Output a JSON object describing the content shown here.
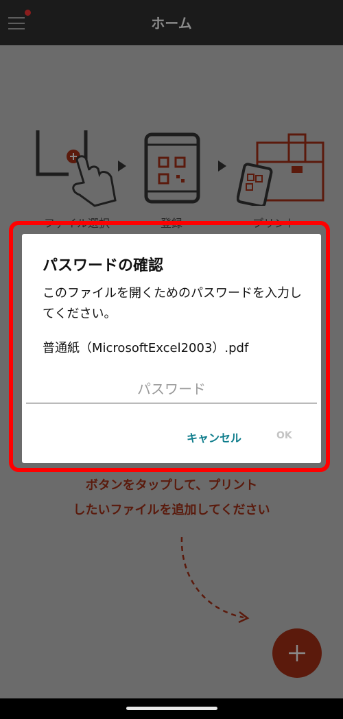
{
  "appbar": {
    "title": "ホーム",
    "menu_icon": "hamburger-menu-icon",
    "notification_dot_color": "#8a1d1d"
  },
  "steps": [
    {
      "label": "ファイル選択",
      "icon": "tablet-tap-icon"
    },
    {
      "label": "登録",
      "icon": "phone-qr-icon"
    },
    {
      "label": "プリント",
      "icon": "printer-qr-icon"
    }
  ],
  "instructions": {
    "line1": "ボタンをタップして、プリント",
    "line2": "したいファイルを追加してください"
  },
  "fab": {
    "icon": "plus-icon",
    "color": "#5b1a0c"
  },
  "dialog": {
    "title": "パスワードの確認",
    "message": "このファイルを開くためのパスワードを入力してください。",
    "filename": "普通紙（MicrosoftExcel2003）.pdf",
    "password_placeholder": "パスワード",
    "password_value": "",
    "cancel_label": "キャンセル",
    "ok_label": "OK",
    "accent_color": "#0f7d8c",
    "highlight_color": "#ff0000"
  }
}
